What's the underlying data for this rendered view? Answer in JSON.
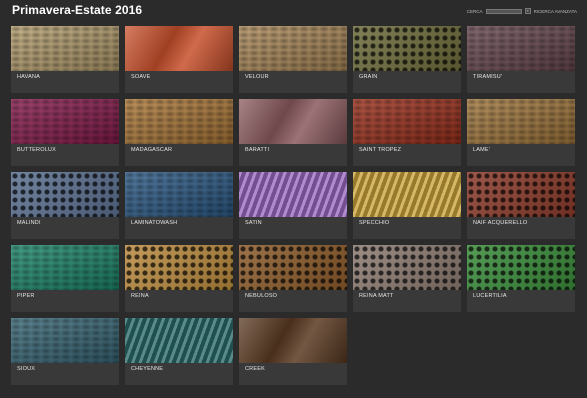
{
  "page": {
    "title": "Primavera-Estate 2016"
  },
  "search": {
    "label": "CERCA",
    "go_label": "»",
    "advanced_label": "RICERCA AVANZATA"
  },
  "tiles": [
    {
      "name": "HAVANA",
      "color": "#b9a271"
    },
    {
      "name": "SOAVE",
      "color": "#c8502c"
    },
    {
      "name": "VELOUR",
      "color": "#b08d5c"
    },
    {
      "name": "GRAIN",
      "color": "#6b6a3a"
    },
    {
      "name": "TIRAMISU'",
      "color": "#6a4a52"
    },
    {
      "name": "BUTTEROLUX",
      "color": "#8a1c4e"
    },
    {
      "name": "MADAGASCAR",
      "color": "#b07b3a"
    },
    {
      "name": "BARATTI",
      "color": "#8a5a5e"
    },
    {
      "name": "SAINT TROPEZ",
      "color": "#a0321e"
    },
    {
      "name": "LAME'",
      "color": "#a57a3e"
    },
    {
      "name": "MALINDI",
      "color": "#5a6f8f"
    },
    {
      "name": "LAMINATOWASH",
      "color": "#2e5d8a"
    },
    {
      "name": "SATIN",
      "color": "#9a6ac0"
    },
    {
      "name": "SPECCHIO",
      "color": "#c9a33a"
    },
    {
      "name": "NAIF ACQUERELLO",
      "color": "#8a3a2a"
    },
    {
      "name": "PIPER",
      "color": "#1e8a6e"
    },
    {
      "name": "REINA",
      "color": "#b8893e"
    },
    {
      "name": "NEBULOSO",
      "color": "#8a5a2a"
    },
    {
      "name": "REINA MATT",
      "color": "#8a7a70"
    },
    {
      "name": "LUCERTILIA",
      "color": "#3a8a3a"
    },
    {
      "name": "SIOUX",
      "color": "#3a6a7a"
    },
    {
      "name": "CHEYENNE",
      "color": "#2a6a6a"
    },
    {
      "name": "CREEK",
      "color": "#5a3a22"
    }
  ]
}
